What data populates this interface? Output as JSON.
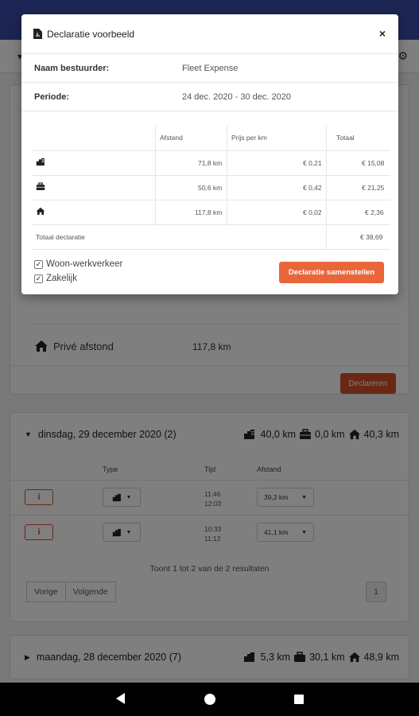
{
  "background": {
    "prive": {
      "label": "Privé afstond",
      "value": "117,8 km"
    },
    "declareren_label": "Declareren",
    "day1": {
      "header": "dinsdag, 29 december 2020 (2)",
      "summary": {
        "woon": "40,0 km",
        "zakelijk": "0,0 km",
        "prive": "40,3 km"
      },
      "columns": {
        "type": "Type",
        "tijd": "Tijd",
        "afstand": "Afstand"
      },
      "rows": [
        {
          "info": "i",
          "time_start": "11:46",
          "time_end": "12:03",
          "distance": "39,2 km"
        },
        {
          "info": "i",
          "time_start": "10:33",
          "time_end": "11:12",
          "distance": "41,1 km"
        }
      ],
      "results_text": "Toont 1 tot 2 van de 2 resultaten",
      "pager": {
        "prev": "Vorige",
        "next": "Volgende",
        "page": "1"
      }
    },
    "day2": {
      "header": "maandag, 28 december 2020 (7)",
      "summary": {
        "woon": "5,3 km",
        "zakelijk": "30,1 km",
        "prive": "48,9 km"
      }
    }
  },
  "modal": {
    "title": "Declaratie voorbeeld",
    "close": "×",
    "driver_label": "Naam bestuurder:",
    "driver_value": "Fleet Expense",
    "period_label": "Periode:",
    "period_value": "24 dec. 2020 - 30 dec. 2020",
    "table": {
      "headers": {
        "afstand": "Afstand",
        "prijs": "Prijs per km",
        "totaal": "Totaal"
      },
      "rows": [
        {
          "icon": "building-icon",
          "afstand": "71,8 km",
          "prijs": "€ 0,21",
          "totaal": "€ 15,08"
        },
        {
          "icon": "briefcase-icon",
          "afstand": "50,6 km",
          "prijs": "€ 0,42",
          "totaal": "€ 21,25"
        },
        {
          "icon": "house-icon",
          "afstand": "117,8 km",
          "prijs": "€ 0,02",
          "totaal": "€ 2,36"
        }
      ],
      "total_label": "Totaal declaratie",
      "total_value": "€ 38,69"
    },
    "checkboxes": [
      {
        "label": "Woon-werkverkeer",
        "checked": true
      },
      {
        "label": "Zakelijk",
        "checked": true
      }
    ],
    "compose_label": "Declaratie samenstellen"
  },
  "colors": {
    "primary": "#3b4aa8",
    "accent": "#e8663a",
    "danger_outline": "#d2502a"
  }
}
